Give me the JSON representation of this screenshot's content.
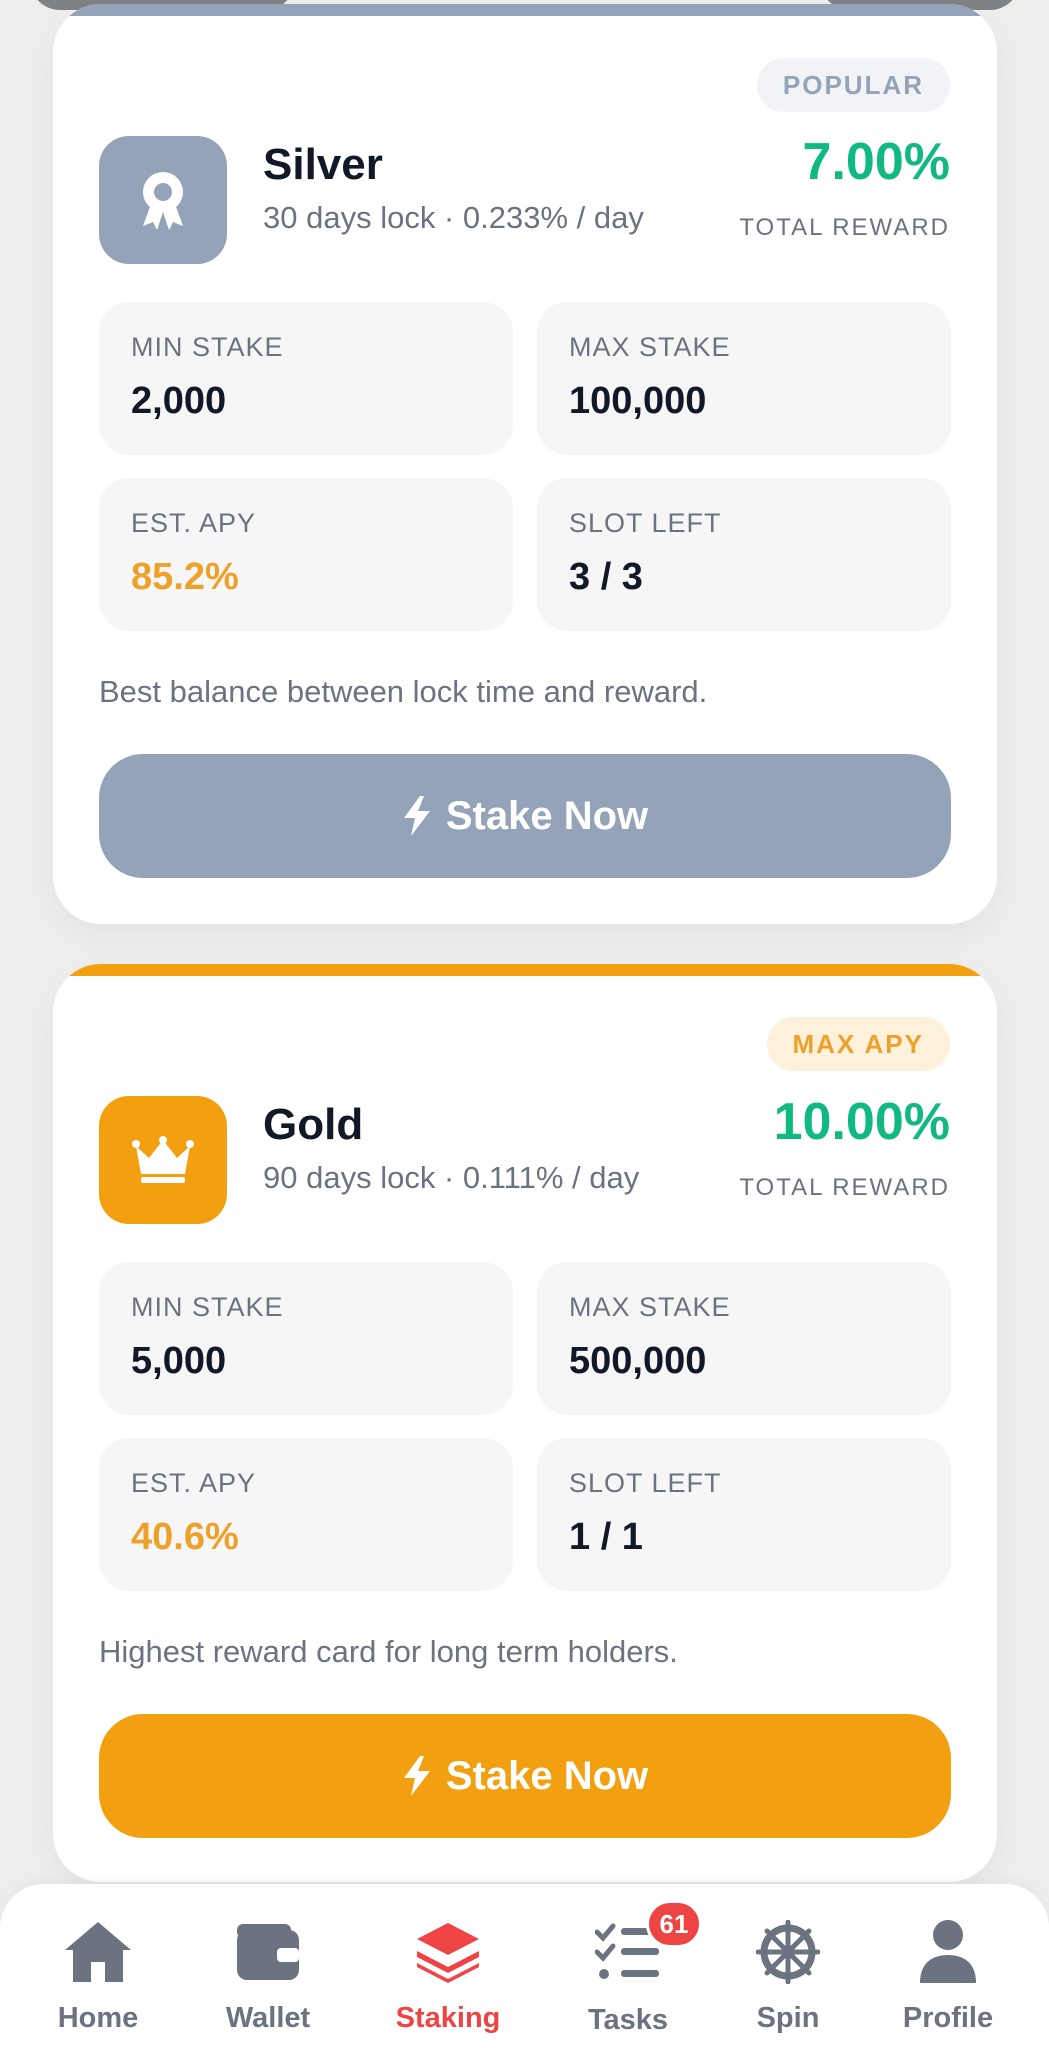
{
  "colors": {
    "silver": "#94a3b8",
    "gold": "#f29f10",
    "reward_green": "#10b981",
    "apy_amber": "#eda12a",
    "active_red": "#ef4444"
  },
  "cards": [
    {
      "tier": "Silver",
      "subtitle": "30 days lock · 0.233% / day",
      "badge": "POPULAR",
      "reward": "7.00%",
      "reward_label": "TOTAL REWARD",
      "icon": "award-icon",
      "stats": {
        "min_label": "MIN STAKE",
        "min_value": "2,000",
        "max_label": "MAX STAKE",
        "max_value": "100,000",
        "apy_label": "EST. APY",
        "apy_value": "85.2%",
        "slot_label": "SLOT LEFT",
        "slot_value": "3 / 3"
      },
      "description": "Best balance between lock time and reward.",
      "button": "Stake Now"
    },
    {
      "tier": "Gold",
      "subtitle": "90 days lock · 0.111% / day",
      "badge": "MAX APY",
      "reward": "10.00%",
      "reward_label": "TOTAL REWARD",
      "icon": "crown-icon",
      "stats": {
        "min_label": "MIN STAKE",
        "min_value": "5,000",
        "max_label": "MAX STAKE",
        "max_value": "500,000",
        "apy_label": "EST. APY",
        "apy_value": "40.6%",
        "slot_label": "SLOT LEFT",
        "slot_value": "1 / 1"
      },
      "description": "Highest reward card for long term holders.",
      "button": "Stake Now"
    }
  ],
  "nav": {
    "items": [
      {
        "label": "Home",
        "icon": "home-icon"
      },
      {
        "label": "Wallet",
        "icon": "wallet-icon"
      },
      {
        "label": "Staking",
        "icon": "layers-icon",
        "active": true
      },
      {
        "label": "Tasks",
        "icon": "tasks-icon",
        "badge": "61"
      },
      {
        "label": "Spin",
        "icon": "wheel-icon"
      },
      {
        "label": "Profile",
        "icon": "user-icon"
      }
    ]
  }
}
